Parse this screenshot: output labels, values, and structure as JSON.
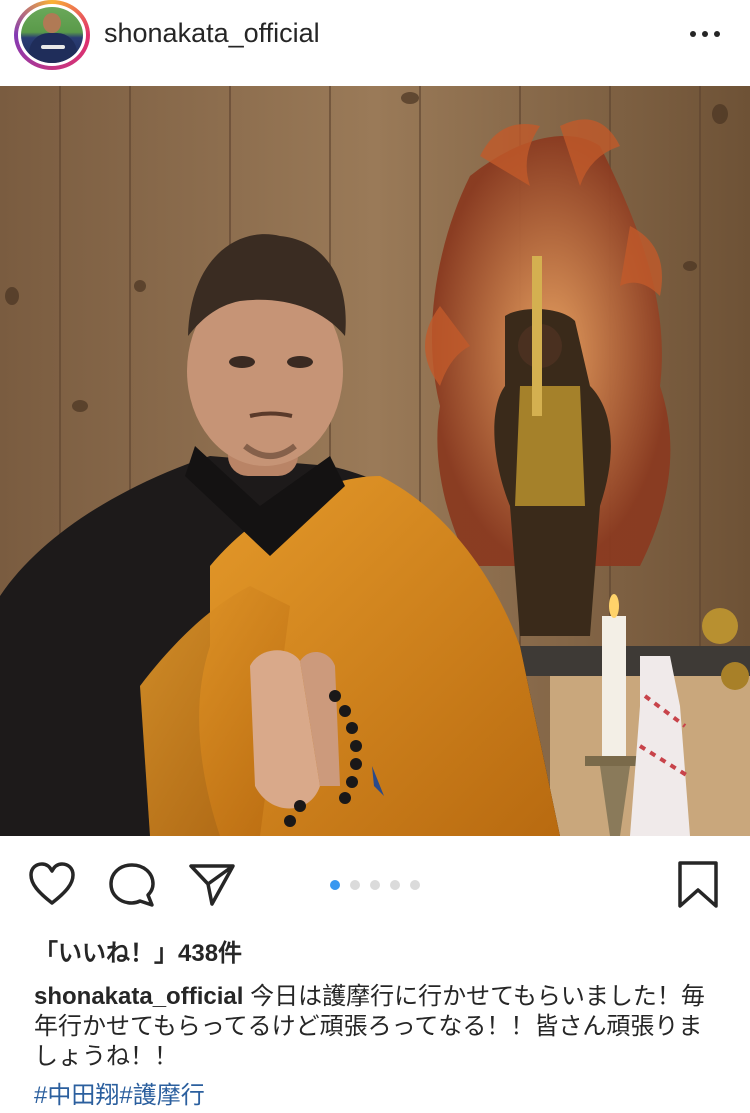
{
  "post": {
    "username": "shonakata_official",
    "more_label": "•••",
    "likes_text": "「いいね！」438件",
    "caption_username": "shonakata_official",
    "caption_text": "今日は護摩行に行かせてもらいました！毎年行かせてもらってるけど頑張ろってなる！！皆さん頑張りましょうね！！",
    "hashtags": [
      "#中田翔",
      "#護摩行"
    ]
  },
  "carousel": {
    "count": 5,
    "active_index": 0
  },
  "icons": {
    "like": "heart-icon",
    "comment": "comment-bubble-icon",
    "share": "paper-plane-icon",
    "save": "bookmark-icon",
    "more": "more-dots-icon"
  },
  "colors": {
    "text": "#262626",
    "hashtag": "#2b5f9e",
    "carousel_active": "#3897f0",
    "carousel_inactive": "#dbdbdb",
    "robe_orange": "#d98a1a",
    "wood_wall": "#8a6a4a"
  }
}
